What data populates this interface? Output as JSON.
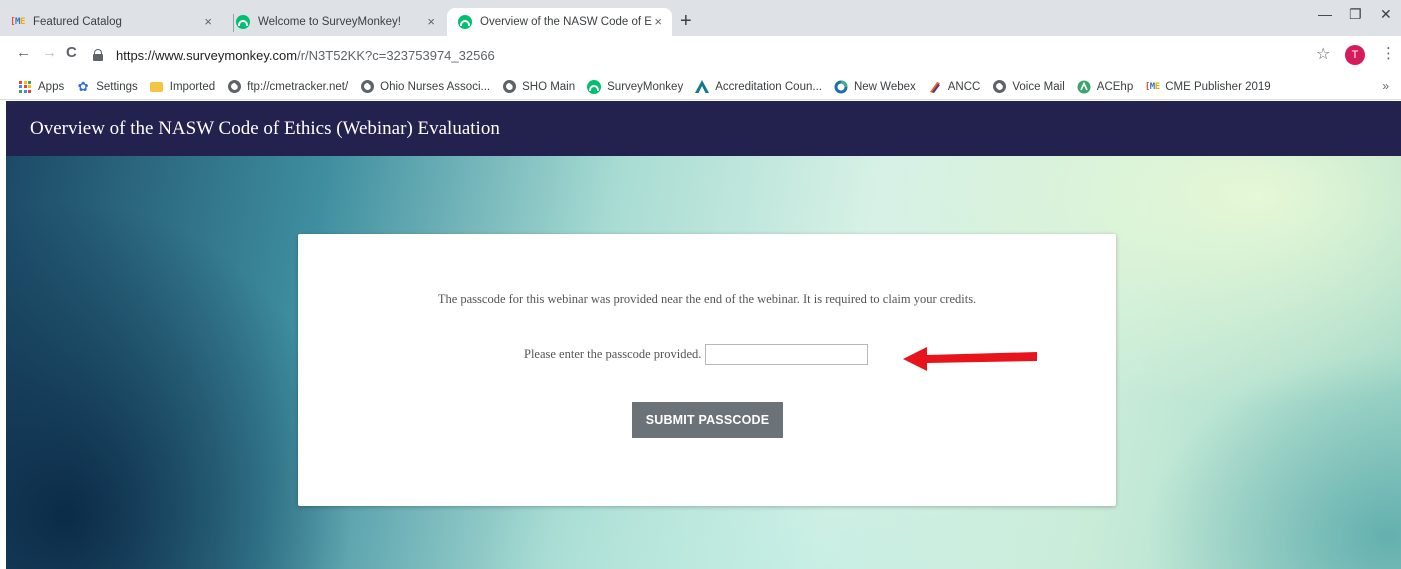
{
  "browser": {
    "tabs": [
      {
        "title": "Featured Catalog",
        "icon": "cme-logo-icon"
      },
      {
        "title": "Welcome to SurveyMonkey!",
        "icon": "surveymonkey-icon"
      },
      {
        "title": "Overview of the NASW Code of E",
        "icon": "surveymonkey-icon",
        "active": true
      }
    ],
    "tab_close": "×",
    "new_tab": "+",
    "window_controls": {
      "minimize": "—",
      "maximize": "❐",
      "close": "✕"
    },
    "nav": {
      "back": "←",
      "forward": "→",
      "reload": "C"
    },
    "url_host": "https://www.surveymonkey.com",
    "url_path": "/r/N3T52KK?c=323753974_32566",
    "profile_initial": "T",
    "star": "☆",
    "menu": "⋮"
  },
  "bookmarks": [
    {
      "label": "Apps",
      "icon": "apps-grid-icon"
    },
    {
      "label": "Settings",
      "icon": "gear-icon"
    },
    {
      "label": "Imported",
      "icon": "folder-icon"
    },
    {
      "label": "ftp://cmetracker.net/",
      "icon": "globe-icon"
    },
    {
      "label": "Ohio Nurses Associ...",
      "icon": "globe-icon"
    },
    {
      "label": "SHO Main",
      "icon": "globe-icon"
    },
    {
      "label": "SurveyMonkey",
      "icon": "surveymonkey-icon"
    },
    {
      "label": "Accreditation Coun...",
      "icon": "triangle-icon"
    },
    {
      "label": "New Webex",
      "icon": "webex-icon"
    },
    {
      "label": "ANCC",
      "icon": "ancc-icon"
    },
    {
      "label": "Voice Mail",
      "icon": "globe-icon"
    },
    {
      "label": "ACEhp",
      "icon": "acehp-icon"
    },
    {
      "label": "CME Publisher 2019",
      "icon": "cme-logo-icon"
    }
  ],
  "bookmarks_more": "»",
  "survey": {
    "title": "Overview of the NASW Code of Ethics (Webinar) Evaluation",
    "instructions": "The passcode for this webinar was provided near the end of the webinar. It is required to claim your credits.",
    "passcode_label": "Please enter the passcode provided.",
    "passcode_value": "",
    "submit_label": "SUBMIT PASSCODE"
  },
  "colors": {
    "header_bg": "#23214e",
    "button_bg": "#6b7378",
    "arrow": "#e8141b",
    "profile": "#d61a5a"
  }
}
